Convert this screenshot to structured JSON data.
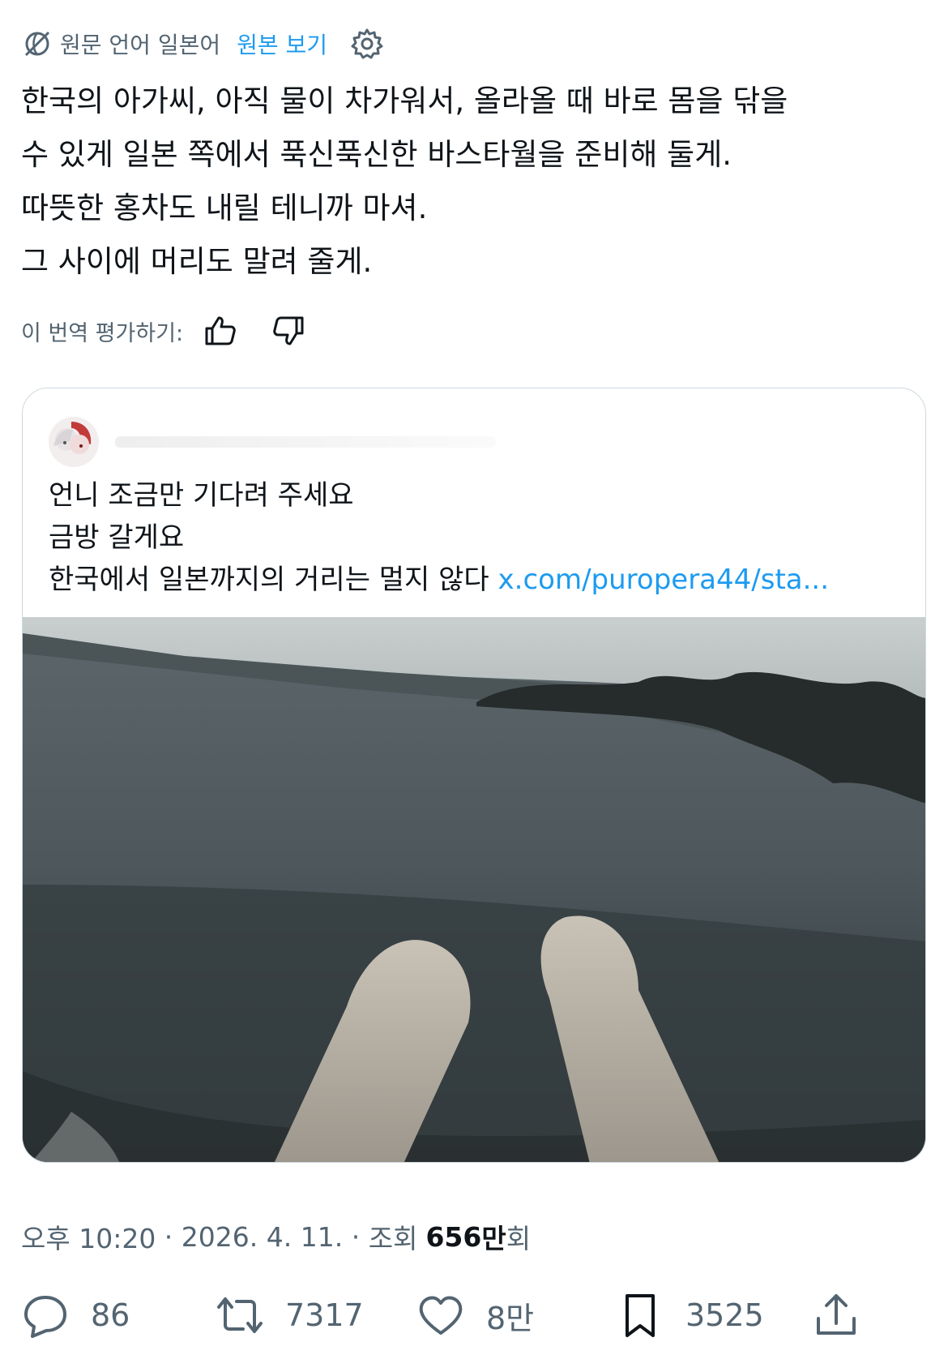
{
  "translation_bar": {
    "source_label": "원문 언어 일본어",
    "show_original": "원본 보기"
  },
  "post": {
    "lines": [
      "한국의 아가씨, 아직 물이 차가워서, 올라올 때 바로 몸을 닦을",
      "수 있게 일본 쪽에서 푹신푹신한 바스타월을 준비해 둘게.",
      "따뜻한 홍차도 내릴 테니까 마셔.",
      "그 사이에 머리도 말려 줄게."
    ]
  },
  "rating": {
    "label": "이 번역 평가하기:"
  },
  "quote": {
    "lines": [
      "언니 조금만 기다려 주세요",
      "금방 갈게요",
      "한국에서 일본까지의 거리는 멀지 않다"
    ],
    "link": "x.com/puropera44/sta..."
  },
  "meta": {
    "time": "오후 10:20",
    "sep1": " · ",
    "date": "2026. 4. 11.",
    "sep2": " · ",
    "views_label": "조회",
    "views_value": "656",
    "views_unit": "만",
    "views_suffix": "회"
  },
  "actions": {
    "replies": "86",
    "reposts": "7317",
    "likes": "8만",
    "bookmarks": "3525"
  },
  "colors": {
    "accent": "#1d9bf0",
    "secondary_text": "#536471",
    "primary_text": "#0f1419",
    "border": "#cfd9de"
  },
  "icons": [
    "translate-globe-icon",
    "gear-icon",
    "thumbs-up-icon",
    "thumbs-down-icon",
    "reply-icon",
    "repost-icon",
    "like-icon",
    "bookmark-icon",
    "share-icon"
  ]
}
